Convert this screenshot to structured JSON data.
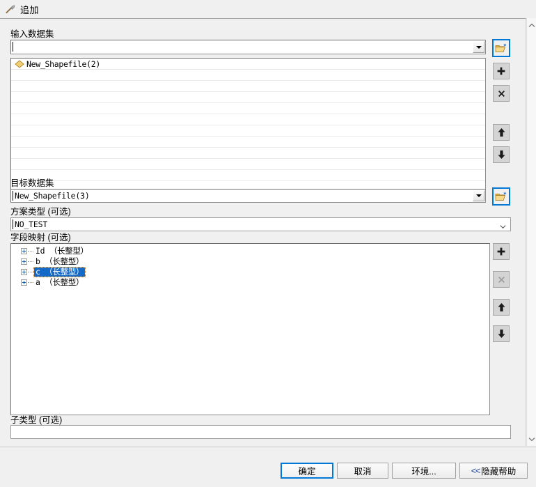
{
  "window": {
    "title": "追加",
    "icon": "hammer-icon"
  },
  "input_datasets": {
    "label": "输入数据集",
    "combo_value": "",
    "combo_placeholder": "",
    "browse_icon": "open-folder-add-icon",
    "items": [
      {
        "name": "New_Shapefile(2)",
        "icon": "polygon-feature-icon"
      }
    ],
    "buttons": {
      "add": "+",
      "remove": "×",
      "move_up": "↑",
      "move_down": "↓"
    }
  },
  "target_dataset": {
    "label": "目标数据集",
    "value": "New_Shapefile(3)",
    "browse_icon": "open-folder-add-icon"
  },
  "schema_type": {
    "label": "方案类型 (可选)",
    "value": "NO_TEST"
  },
  "field_map": {
    "label": "字段映射 (可选)",
    "items": [
      {
        "name": "Id （长整型）",
        "selected": false
      },
      {
        "name": "b （长整型）",
        "selected": false
      },
      {
        "name": "c （长整型）",
        "selected": true
      },
      {
        "name": "a （长整型）",
        "selected": false
      }
    ],
    "buttons": {
      "add": "+",
      "remove": "×",
      "move_up": "↑",
      "move_down": "↓"
    }
  },
  "subtype": {
    "label": "子类型 (可选)",
    "value": ""
  },
  "footer": {
    "ok": "确定",
    "cancel": "取消",
    "environments": "环境...",
    "hide_help_prefix": "<<",
    "hide_help": "隐藏帮助"
  },
  "colors": {
    "focus_blue": "#0078d7",
    "selection_blue": "#1569c7",
    "window_bg": "#f0f0f0",
    "field_bg": "#ffffff",
    "polygon_fill": "#f2cf77"
  }
}
